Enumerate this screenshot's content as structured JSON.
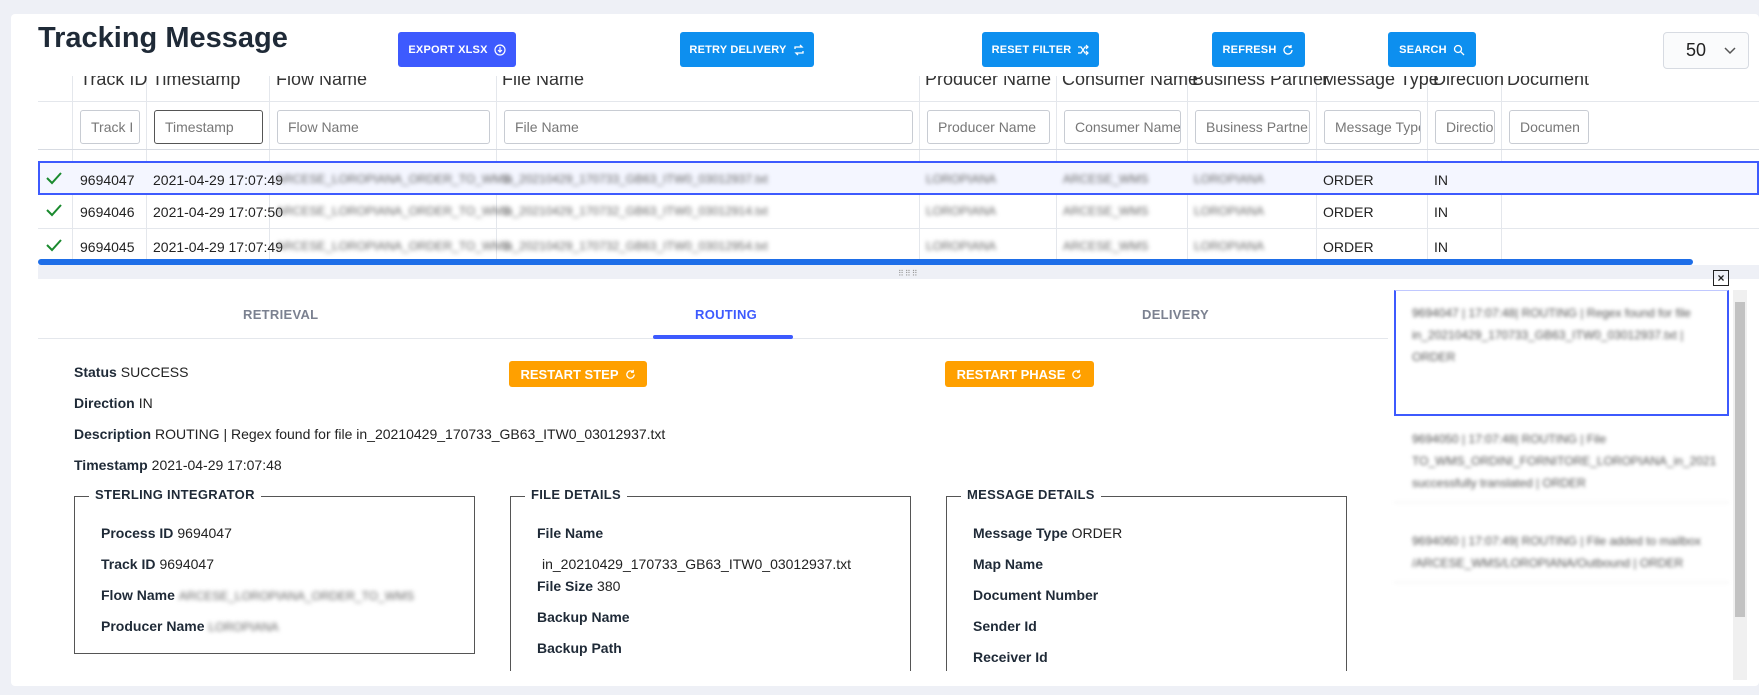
{
  "title": "Tracking Message",
  "toolbar": {
    "export": "EXPORT XLSX",
    "retry": "RETRY DELIVERY",
    "reset": "RESET FILTER",
    "refresh": "REFRESH",
    "search": "SEARCH",
    "page_size": "50"
  },
  "grid": {
    "headers": [
      "Track ID",
      "Timestamp",
      "Flow Name",
      "File Name",
      "Producer Name",
      "Consumer Name",
      "Business Partner",
      "Message Type",
      "Direction",
      "Document"
    ],
    "filters": [
      "Track I",
      "Timestamp",
      "Flow Name",
      "File Name",
      "Producer Name",
      "Consumer Name",
      "Business Partner",
      "Message Type",
      "Directio",
      "Documen"
    ],
    "rows": [
      {
        "track_id": "9694047",
        "timestamp": "2021-04-29 17:07:49",
        "flow": "ARCESE_LOROPIANA_ORDER_TO_WMS",
        "file": "in_20210429_170733_GB63_ITW0_03012937.txt",
        "producer": "LOROPIANA",
        "consumer": "ARCESE_WMS",
        "partner": "LOROPIANA",
        "type": "ORDER",
        "direction": "IN"
      },
      {
        "track_id": "9694046",
        "timestamp": "2021-04-29 17:07:50",
        "flow": "ARCESE_LOROPIANA_ORDER_TO_WMS",
        "file": "in_20210429_170732_GB63_ITW0_03012914.txt",
        "producer": "LOROPIANA",
        "consumer": "ARCESE_WMS",
        "partner": "LOROPIANA",
        "type": "ORDER",
        "direction": "IN"
      },
      {
        "track_id": "9694045",
        "timestamp": "2021-04-29 17:07:49",
        "flow": "ARCESE_LOROPIANA_ORDER_TO_WMS",
        "file": "in_20210429_170732_GB63_ITW0_03012954.txt",
        "producer": "LOROPIANA",
        "consumer": "ARCESE_WMS",
        "partner": "LOROPIANA",
        "type": "ORDER",
        "direction": "IN"
      }
    ]
  },
  "tabs": {
    "retrieval": "RETRIEVAL",
    "routing": "ROUTING",
    "delivery": "DELIVERY"
  },
  "detail": {
    "status_label": "Status",
    "status": "SUCCESS",
    "direction_label": "Direction",
    "direction": "IN",
    "description_label": "Description",
    "description": "ROUTING | Regex found for file in_20210429_170733_GB63_ITW0_03012937.txt",
    "timestamp_label": "Timestamp",
    "timestamp": "2021-04-29 17:07:48",
    "restart_step": "RESTART STEP",
    "restart_phase": "RESTART PHASE"
  },
  "sterling": {
    "legend": "STERLING INTEGRATOR",
    "process_id_label": "Process ID",
    "process_id": "9694047",
    "track_id_label": "Track ID",
    "track_id": "9694047",
    "flow_name_label": "Flow Name",
    "flow_name": "ARCESE_LOROPIANA_ORDER_TO_WMS",
    "producer_name_label": "Producer Name",
    "producer_name": "LOROPIANA"
  },
  "file_details": {
    "legend": "FILE DETAILS",
    "file_name_label": "File Name",
    "file_name": "in_20210429_170733_GB63_ITW0_03012937.txt",
    "file_size_label": "File Size",
    "file_size": "380",
    "backup_name_label": "Backup Name",
    "backup_path_label": "Backup Path"
  },
  "message_details": {
    "legend": "MESSAGE DETAILS",
    "message_type_label": "Message Type",
    "message_type": "ORDER",
    "map_name_label": "Map Name",
    "document_number_label": "Document Number",
    "sender_id_label": "Sender Id",
    "receiver_id_label": "Receiver Id"
  },
  "log": [
    "9694047 | 17:07:48| ROUTING | Regex found for file in_20210429_170733_GB63_ITW0_03012937.txt | ORDER",
    "9694050 | 17:07:48| ROUTING | File TO_WMS_ORDINI_FORNITORE_LOROPIANA_in_2021 successfully translated | ORDER",
    "9694060 | 17:07:49| ROUTING | File added to mailbox /ARCESE_WMS/LOROPIANA/Outbound | ORDER"
  ],
  "colors": {
    "primary": "#3d5afe",
    "cyan": "#0d8fef",
    "orange": "#ffa000",
    "check": "#1a8a2e"
  }
}
